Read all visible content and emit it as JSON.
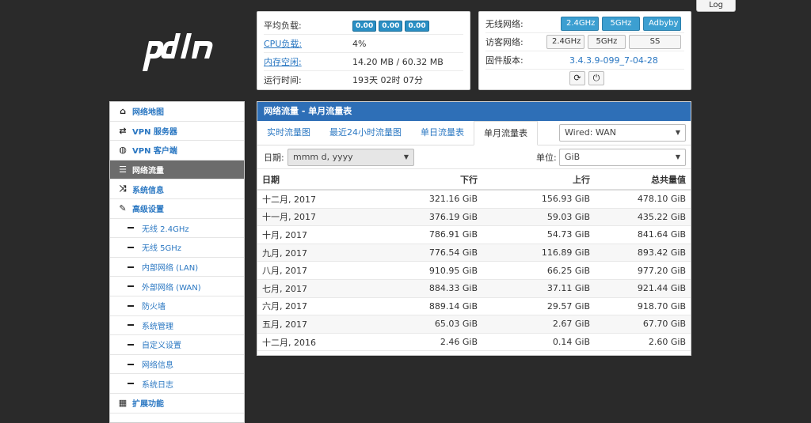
{
  "header": {
    "logout_label": "Log",
    "logo_text": "pdn"
  },
  "status": {
    "load_label": "平均负载:",
    "load_values": [
      "0.00",
      "0.00",
      "0.00"
    ],
    "cpu_label": "CPU负载:",
    "cpu_value": "4%",
    "mem_label": "内存空闲:",
    "mem_value": "14.20 MB / 60.32 MB",
    "uptime_label": "运行时间:",
    "uptime_value": "193天 02时 07分"
  },
  "wireless": {
    "wifi_label": "无线网络:",
    "wifi_buttons": [
      "2.4GHz",
      "5GHz",
      "Adbyby"
    ],
    "guest_label": "访客网络:",
    "guest_buttons": [
      "2.4GHz",
      "5GHz",
      "SS"
    ],
    "fw_label": "固件版本:",
    "fw_value": "3.4.3.9-099_7-04-28"
  },
  "sidebar": {
    "items": [
      {
        "label": "网络地图",
        "icon": "home-icon"
      },
      {
        "label": "VPN 服务器",
        "icon": "retweet-icon"
      },
      {
        "label": "VPN 客户端",
        "icon": "globe-icon"
      },
      {
        "label": "网络流量",
        "icon": "list-icon",
        "active": true
      },
      {
        "label": "系统信息",
        "icon": "random-icon"
      },
      {
        "label": "高级设置",
        "icon": "wrench-icon"
      }
    ],
    "subitems": [
      "无线 2.4GHz",
      "无线 5GHz",
      "内部网络 (LAN)",
      "外部网络 (WAN)",
      "防火墙",
      "系统管理",
      "自定义设置",
      "网络信息",
      "系统日志"
    ],
    "extra": {
      "label": "扩展功能",
      "icon": "grid-icon"
    }
  },
  "main": {
    "title": "网络流量 - 单月流量表",
    "tabs": [
      "实时流量图",
      "最近24小时流量图",
      "单日流量表",
      "单月流量表"
    ],
    "active_tab": 3,
    "interface_select": "Wired: WAN",
    "date_label": "日期:",
    "date_format_select": "mmm d, yyyy",
    "unit_label": "单位:",
    "unit_select": "GiB",
    "columns": [
      "日期",
      "下行",
      "上行",
      "总共量值"
    ],
    "rows": [
      [
        "十二月, 2017",
        "321.16 GiB",
        "156.93 GiB",
        "478.10 GiB"
      ],
      [
        "十一月, 2017",
        "376.19 GiB",
        "59.03 GiB",
        "435.22 GiB"
      ],
      [
        "十月, 2017",
        "786.91 GiB",
        "54.73 GiB",
        "841.64 GiB"
      ],
      [
        "九月, 2017",
        "776.54 GiB",
        "116.89 GiB",
        "893.42 GiB"
      ],
      [
        "八月, 2017",
        "910.95 GiB",
        "66.25 GiB",
        "977.20 GiB"
      ],
      [
        "七月, 2017",
        "884.33 GiB",
        "37.11 GiB",
        "921.44 GiB"
      ],
      [
        "六月, 2017",
        "889.14 GiB",
        "29.57 GiB",
        "918.70 GiB"
      ],
      [
        "五月, 2017",
        "65.03 GiB",
        "2.67 GiB",
        "67.70 GiB"
      ],
      [
        "十二月, 2016",
        "2.46 GiB",
        "0.14 GiB",
        "2.60 GiB"
      ]
    ]
  },
  "colors": {
    "accent": "#2e6fb7",
    "active_nav": "#6c6c6c",
    "badge": "#2a8fc4"
  }
}
